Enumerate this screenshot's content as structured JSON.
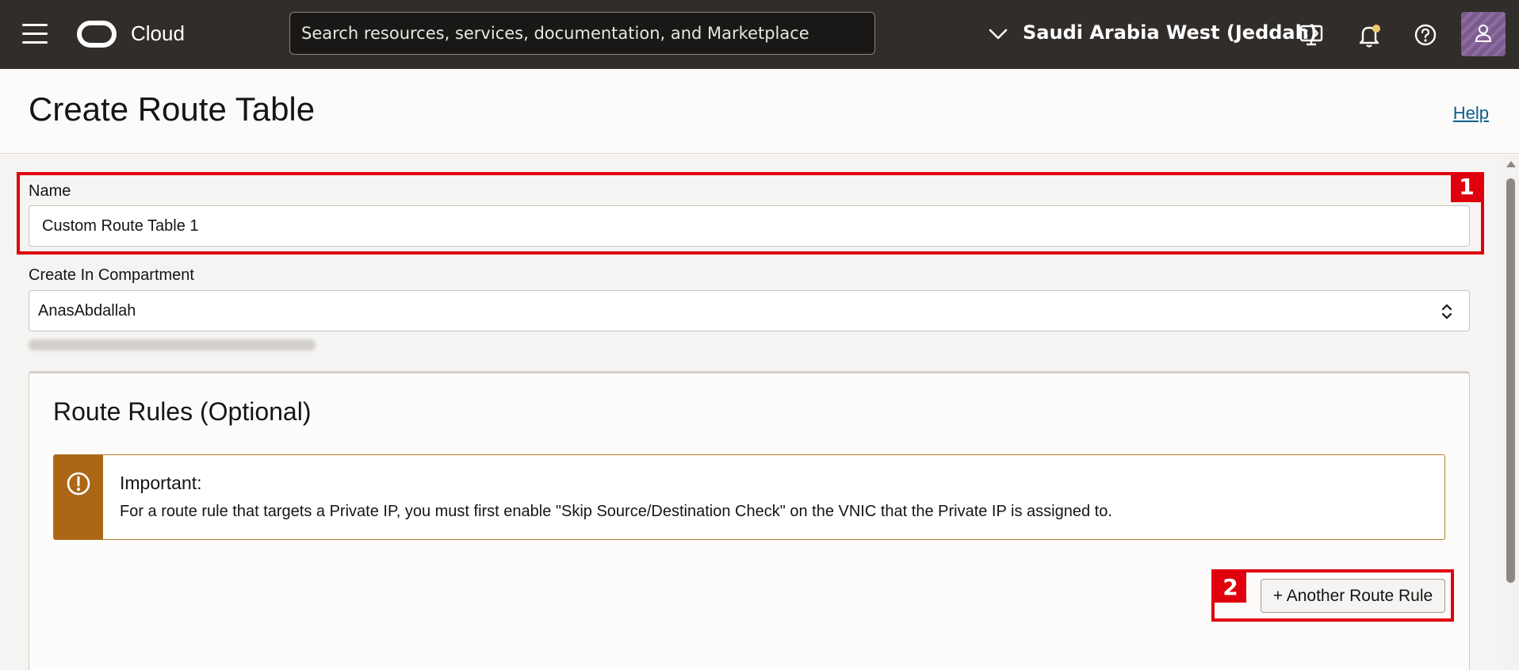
{
  "topbar": {
    "brand": "Cloud",
    "search_placeholder": "Search resources, services, documentation, and Marketplace",
    "region": "Saudi Arabia West (Jeddah)",
    "icons": [
      "menu-icon",
      "oracle-logo-icon",
      "chevron-down-icon",
      "cloud-shell-icon",
      "bell-icon",
      "help-icon",
      "user-icon"
    ]
  },
  "header": {
    "title": "Create Route Table",
    "help": "Help"
  },
  "form": {
    "name_label": "Name",
    "name_value": "Custom Route Table 1",
    "compartment_label": "Create In Compartment",
    "compartment_value": "AnasAbdallah"
  },
  "route_rules": {
    "title": "Route Rules (Optional)",
    "alert_title": "Important:",
    "alert_text": "For a route rule that targets a Private IP, you must first enable \"Skip Source/Destination Check\" on the VNIC that the Private IP is assigned to.",
    "add_button": "+ Another Route Rule"
  },
  "annotations": [
    "1",
    "2"
  ],
  "colors": {
    "topbar": "#312d2a",
    "highlight": "#e0000d",
    "alert_accent": "#ab6616",
    "link": "#0d5d8c"
  }
}
